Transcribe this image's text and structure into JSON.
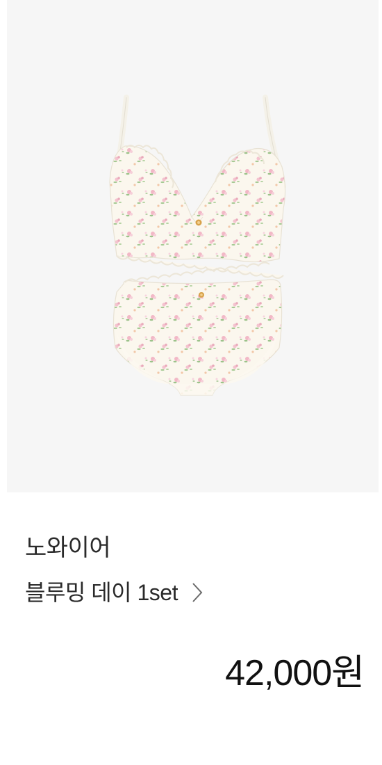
{
  "product": {
    "brand": "노와이어",
    "name": "블루밍 데이 1set",
    "price": "42,000원",
    "image_icon": "lingerie-set-image",
    "chevron_icon": "chevron-right-icon"
  },
  "colors": {
    "image_background": "#f6f6f6",
    "text_primary": "#2a2a2a",
    "price_text": "#111111",
    "fabric": "#fbf7ee",
    "floral_pink": "#f2b8c6",
    "floral_green": "#9cc28a",
    "button_gold": "#d8a24a"
  }
}
